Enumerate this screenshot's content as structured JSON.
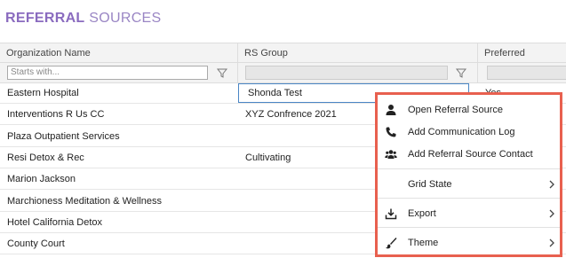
{
  "page_title": {
    "bold": "REFERRAL",
    "light": "SOURCES"
  },
  "grid": {
    "columns": [
      "Organization Name",
      "RS Group",
      "Preferred"
    ],
    "filter_placeholder": "Starts with...",
    "rows": [
      [
        "Eastern Hospital",
        "Shonda Test",
        "Yes"
      ],
      [
        "Interventions R Us CC",
        "XYZ Confrence 2021",
        ""
      ],
      [
        "Plaza Outpatient Services",
        "",
        ""
      ],
      [
        "Resi Detox & Rec",
        "Cultivating",
        ""
      ],
      [
        "Marion Jackson",
        "",
        ""
      ],
      [
        "Marchioness Meditation & Wellness",
        "",
        ""
      ],
      [
        "Hotel California Detox",
        "",
        ""
      ],
      [
        "County Court",
        "",
        ""
      ]
    ]
  },
  "context_menu": {
    "items": [
      {
        "label": "Open Referral Source",
        "icon": "user-icon"
      },
      {
        "label": "Add Communication Log",
        "icon": "phone-icon"
      },
      {
        "label": "Add Referral Source Contact",
        "icon": "users-icon"
      },
      {
        "label": "Grid State",
        "icon": "",
        "submenu": true
      },
      {
        "label": "Export",
        "icon": "download-icon",
        "submenu": true
      },
      {
        "label": "Theme",
        "icon": "brush-icon",
        "submenu": true
      }
    ],
    "highlight_color": "#e8604f"
  }
}
